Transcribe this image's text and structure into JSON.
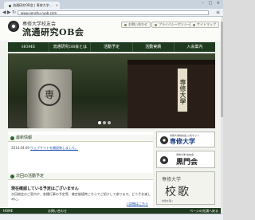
{
  "browser": {
    "tab_title": "流通研究OB会 | 専修大学…",
    "tab_close": "×",
    "window_controls": "– □ ×",
    "back": "◀",
    "forward": "▶",
    "reload": "↻",
    "url": "www.senshu-ryob.com",
    "menu": "≡"
  },
  "header": {
    "subtitle": "専修大学校友会",
    "title": "流通研究OB会",
    "buttons": [
      {
        "label": "お問い合わせ"
      },
      {
        "label": "プライバシーポリシー"
      },
      {
        "label": "サイトマップ"
      }
    ]
  },
  "nav": {
    "items": [
      "HOME",
      "流通研究OB会とは",
      "活動予定",
      "活動実績",
      "入会案内"
    ]
  },
  "hero": {
    "stone_mark": "専",
    "sign_text": "専修大學"
  },
  "news": {
    "heading": "最新情報",
    "items": [
      {
        "date": "2014.04.09",
        "text": "ウェブサイトを開設致しました。"
      }
    ]
  },
  "event": {
    "heading": "次回の活動予定",
    "title": "現在確認している予定はございません",
    "body": "次回総会のご案内や、各種行事の予定等、確定後随時こちらでご紹介して参ります。どうぞお楽しみに。",
    "link": "▷詳細はこちら"
  },
  "sidebar": {
    "banner1": {
      "small": "専修大学校友会 公式サイト",
      "big": "専修大学"
    },
    "banner2": {
      "small": "専修大学 校友会",
      "big": "黒門会"
    },
    "banner3": {
      "small": "専修大学",
      "big": "校歌",
      "sub": "校歌を聴く"
    }
  },
  "footer": {
    "home": "HOME",
    "contact": "お問い合わせ",
    "pagetop": "ページの先頭へ戻る"
  },
  "colors": {
    "nav_bg": "#1f3b1f",
    "link": "#1a4fb0",
    "page_bg": "#f1f3ef"
  }
}
